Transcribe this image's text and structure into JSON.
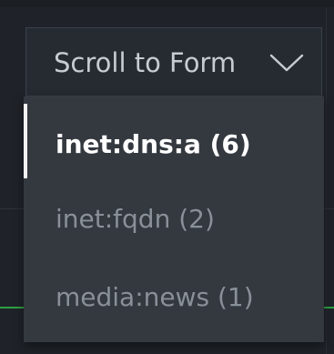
{
  "dropdown": {
    "toggle_label": "Scroll to Form",
    "chevron_icon": "chevron-down-icon",
    "items": [
      {
        "label": "inet:dns:a (6)",
        "active": true
      },
      {
        "label": "inet:fqdn (2)",
        "active": false
      },
      {
        "label": "media:news (1)",
        "active": false
      }
    ]
  },
  "colors": {
    "background": "#1f2329",
    "menu_background": "#343940",
    "active_text": "#ffffff",
    "inactive_text": "#8a9098",
    "accent_line": "#2ea043"
  }
}
